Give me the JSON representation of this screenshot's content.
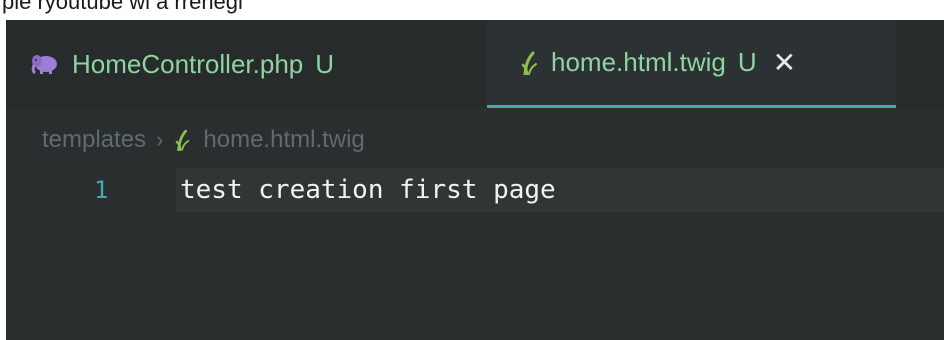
{
  "caption": "ple ryoutube wi a rrenegi",
  "tabs": [
    {
      "filename": "HomeController.php",
      "status": "U",
      "icon": "php-elephant-icon",
      "active": false
    },
    {
      "filename": "home.html.twig",
      "status": "U",
      "icon": "twig-icon",
      "active": true,
      "close_glyph": "✕"
    }
  ],
  "breadcrumb": {
    "folder": "templates",
    "separator": "›",
    "file": "home.html.twig"
  },
  "editor": {
    "lines": [
      {
        "number": "1",
        "text": "test creation first page"
      }
    ]
  },
  "colors": {
    "background": "#2a2e2f",
    "tab_text": "#8fd3a0",
    "active_tab_border": "#4aa8b0",
    "line_number": "#4aa8b0",
    "breadcrumb": "#5f6b6c",
    "php_icon": "#9b7fd4",
    "twig_icon": "#8bc34a"
  }
}
